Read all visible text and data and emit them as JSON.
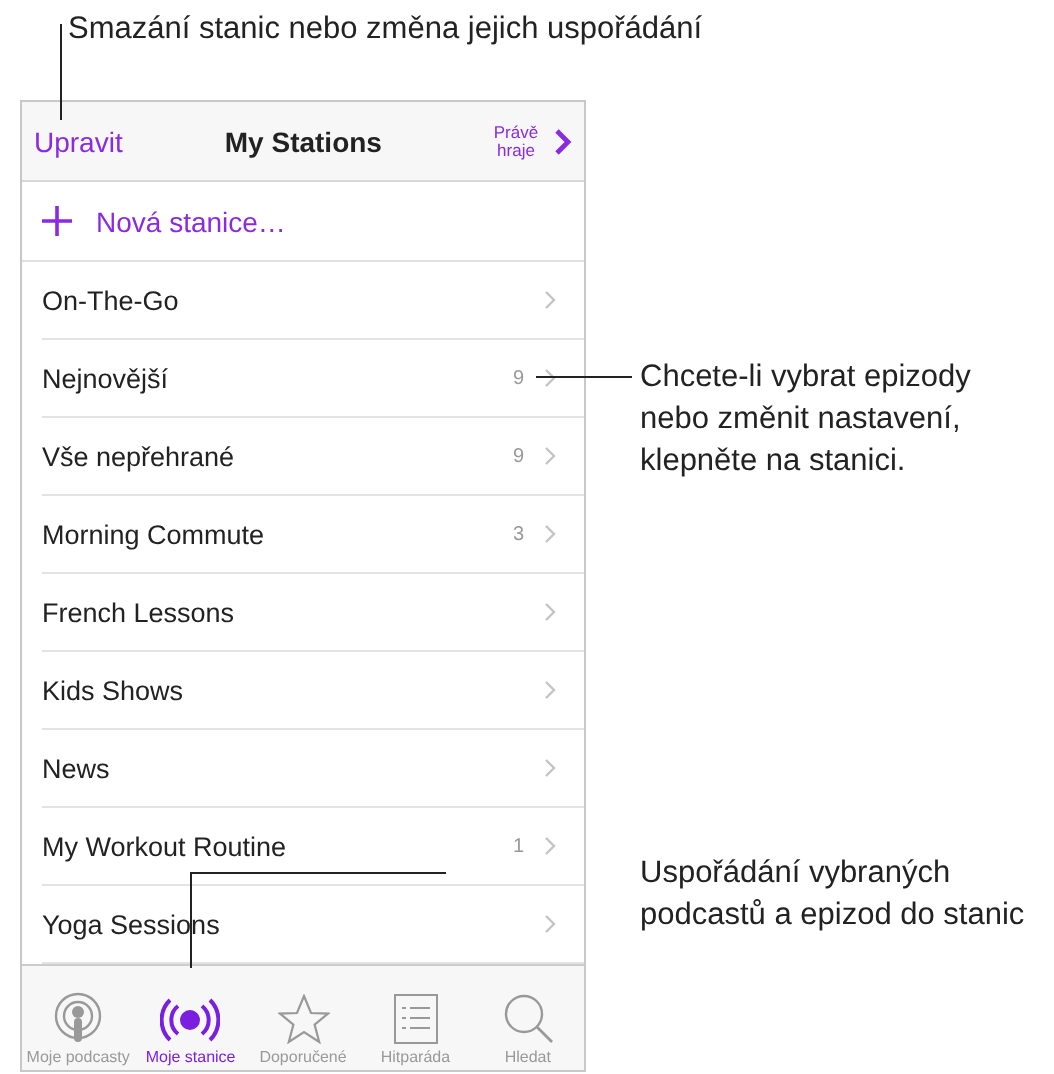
{
  "callouts": [
    {
      "text": "Smazání stanic nebo změna jejich uspořádání"
    },
    {
      "text": "Chcete-li vybrat epizody nebo změnit nastavení, klepněte na stanici."
    },
    {
      "text": "Uspořádání vybraných podcastů a epizod do stanic"
    }
  ],
  "nav_bar": {
    "edit": "Upravit",
    "title": "My Stations",
    "now_playing": "Právě hraje"
  },
  "new_station": {
    "label": "Nová stanice…"
  },
  "stations": [
    {
      "name": "On-The-Go"
    },
    {
      "name": "Nejnovější",
      "count": "9"
    },
    {
      "name": "Vše nepřehrané",
      "count": "9"
    },
    {
      "name": "Morning Commute",
      "count": "3"
    },
    {
      "name": "French Lessons"
    },
    {
      "name": "Kids Shows"
    },
    {
      "name": "News"
    },
    {
      "name": "My Workout Routine",
      "count": "1"
    },
    {
      "name": "Yoga Sessions"
    }
  ],
  "tab_bar": [
    {
      "kind": "podcasts",
      "label": "Moje podcasty",
      "selected": false
    },
    {
      "kind": "stations",
      "label": "Moje stanice",
      "selected": true
    },
    {
      "kind": "featured",
      "label": "Doporučené",
      "selected": false
    },
    {
      "kind": "charts",
      "label": "Hitparáda",
      "selected": false
    },
    {
      "kind": "search",
      "label": "Hledat",
      "selected": false
    }
  ]
}
